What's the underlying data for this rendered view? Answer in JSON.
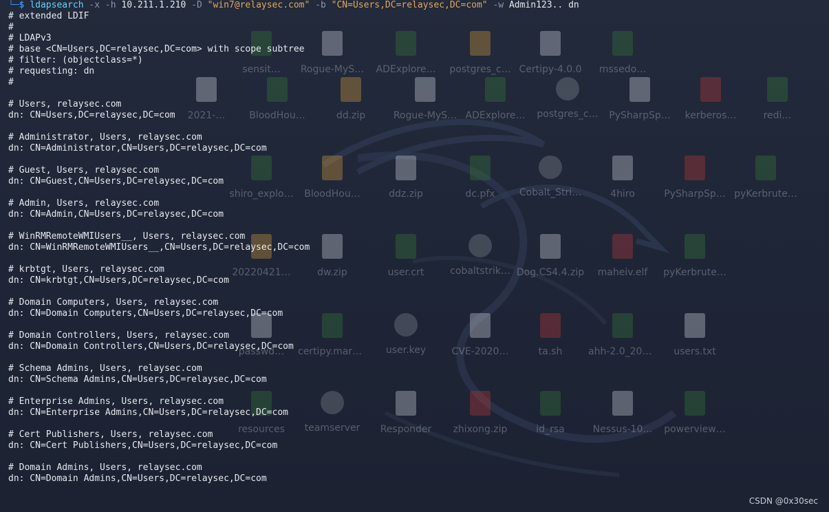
{
  "terminal": {
    "prompt": {
      "arrow": "└─",
      "dollar": "$",
      "command": "ldapsearch",
      "flag_x": "-x",
      "flag_h": "-h",
      "host": "10.211.1.210",
      "flag_D": "-D",
      "bind_dn": "\"win7@relaysec.com\"",
      "flag_b": "-b",
      "base_dn": "\"CN=Users,DC=relaysec,DC=com\"",
      "flag_w": "-w",
      "password": "Admin123..",
      "attribute": "dn"
    },
    "output_lines": [
      "# extended LDIF",
      "#",
      "# LDAPv3",
      "# base <CN=Users,DC=relaysec,DC=com> with scope subtree",
      "# filter: (objectclass=*)",
      "# requesting: dn",
      "#",
      "",
      "# Users, relaysec.com",
      "dn: CN=Users,DC=relaysec,DC=com",
      "",
      "# Administrator, Users, relaysec.com",
      "dn: CN=Administrator,CN=Users,DC=relaysec,DC=com",
      "",
      "# Guest, Users, relaysec.com",
      "dn: CN=Guest,CN=Users,DC=relaysec,DC=com",
      "",
      "# Admin, Users, relaysec.com",
      "dn: CN=Admin,CN=Users,DC=relaysec,DC=com",
      "",
      "# WinRMRemoteWMIUsers__, Users, relaysec.com",
      "dn: CN=WinRMRemoteWMIUsers__,CN=Users,DC=relaysec,DC=com",
      "",
      "# krbtgt, Users, relaysec.com",
      "dn: CN=krbtgt,CN=Users,DC=relaysec,DC=com",
      "",
      "# Domain Computers, Users, relaysec.com",
      "dn: CN=Domain Computers,CN=Users,DC=relaysec,DC=com",
      "",
      "# Domain Controllers, Users, relaysec.com",
      "dn: CN=Domain Controllers,CN=Users,DC=relaysec,DC=com",
      "",
      "# Schema Admins, Users, relaysec.com",
      "dn: CN=Schema Admins,CN=Users,DC=relaysec,DC=com",
      "",
      "# Enterprise Admins, Users, relaysec.com",
      "dn: CN=Enterprise Admins,CN=Users,DC=relaysec,DC=com",
      "",
      "# Cert Publishers, Users, relaysec.com",
      "dn: CN=Cert Publishers,CN=Users,DC=relaysec,DC=com",
      "",
      "# Domain Admins, Users, relaysec.com",
      "dn: CN=Domain Admins,CN=Users,DC=relaysec,DC=com"
    ]
  },
  "desktop": {
    "rows": [
      [
        "sensit…",
        "Rogue-MyS…",
        "ADExplore…",
        "postgres_c…",
        "Certipy-4.0.0",
        "mssedo…"
      ],
      [
        "2021-…",
        "BloodHou…",
        "dd.zip",
        "Rogue-MyS…",
        "ADExplore…",
        "postgres_c…",
        "PySharpSp…",
        "kerberos…",
        "redi…"
      ],
      [
        "shiro_explo…",
        "BloodHou…",
        "ddz.zip",
        "dc.pfx",
        "Cobalt_Stri…",
        "4hiro",
        "PySharpSp…",
        "pyKerbrute…"
      ],
      [
        "20220421…",
        "dw.zip",
        "user.crt",
        "cobaltstrik…",
        "Dog.CS4.4.zip",
        "maheiv.elf",
        "pyKerbrute…"
      ],
      [
        "passwd…",
        "certipy.mara…",
        "user.key",
        "CVE-2020…",
        "ta.sh",
        "ahh-2.0_202…",
        "users.txt"
      ],
      [
        "resources",
        "teamserver",
        "Responder",
        "zhixong.zip",
        "id_rsa",
        "Nessus-10…",
        "powerview…"
      ]
    ]
  },
  "watermark": "CSDN @0x30sec",
  "colors": {
    "background": "#1f2535",
    "prompt": "#3b8eea",
    "command": "#5fd7ff",
    "option": "#8a96b0",
    "string": "#e5a65a",
    "text": "#e6e8ee"
  }
}
